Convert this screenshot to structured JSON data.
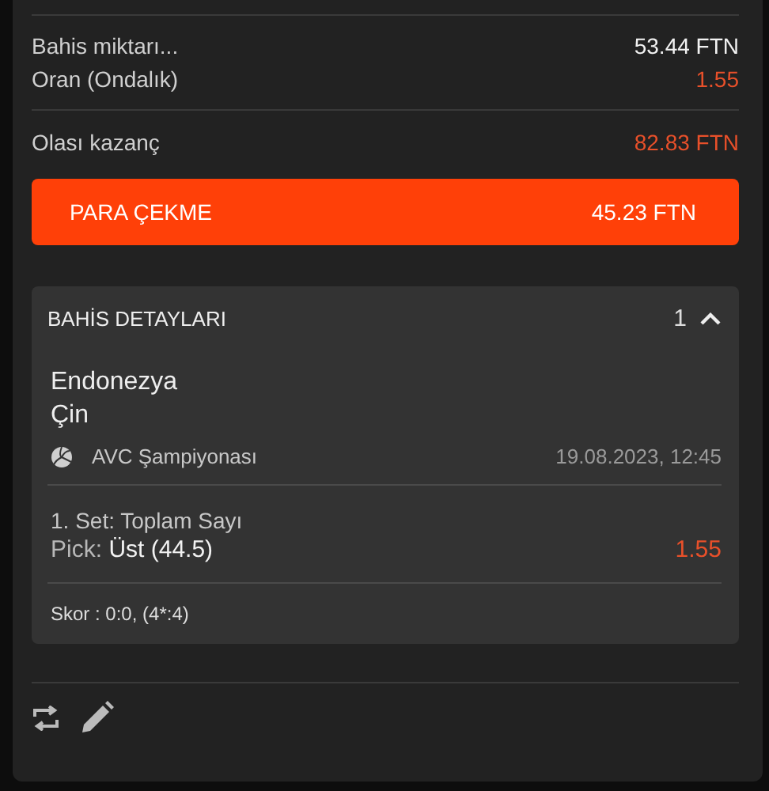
{
  "summary": [
    {
      "label": "Bahis miktarı...",
      "value": "53.44 FTN",
      "highlight": false
    },
    {
      "label": "Oran (Ondalık)",
      "value": "1.55",
      "highlight": true
    }
  ],
  "potential": {
    "label": "Olası kazanç",
    "value": "82.83 FTN",
    "highlight": true
  },
  "cashout_button": {
    "label": "PARA ÇEKME",
    "amount": "45.23 FTN"
  },
  "details": {
    "title": "BAHİS DETAYLARI",
    "count": "1",
    "expanded": true,
    "teams": [
      "Endonezya",
      "Çin"
    ],
    "league": "AVC Şampiyonası",
    "datetime": "19.08.2023, 12:45",
    "market": "1. Set: Toplam Sayı",
    "pick_label": "Pick:",
    "pick_value": "Üst (44.5)",
    "odds": "1.55",
    "score": "Skor : 0:0, (4*:4)"
  }
}
